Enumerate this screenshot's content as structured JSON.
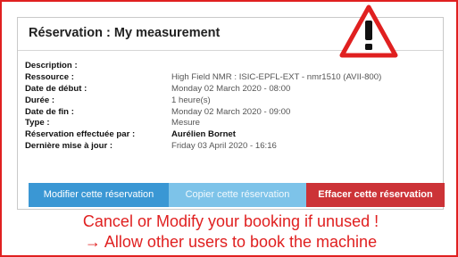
{
  "panel": {
    "title": "Réservation : My measurement",
    "rows": [
      {
        "label": "Description :",
        "value": ""
      },
      {
        "label": "Ressource :",
        "value": "High Field NMR : ISIC-EPFL-EXT - nmr1510 (AVII-800)"
      },
      {
        "label": "Date de début :",
        "value": "Monday 02 March 2020 - 08:00"
      },
      {
        "label": "Durée :",
        "value": "1 heure(s)"
      },
      {
        "label": "Date de fin :",
        "value": "Monday 02 March 2020 - 09:00"
      },
      {
        "label": "Type :",
        "value": "Mesure"
      },
      {
        "label": "Réservation effectuée par :",
        "value": "Aurélien Bornet"
      },
      {
        "label": "Dernière mise à jour :",
        "value": "Friday 03 April 2020 - 16:16"
      }
    ]
  },
  "buttons": {
    "modify_label": "Modifier cette réservation",
    "copy_label": "Copier cette réservation",
    "delete_label": "Effacer cette réservation"
  },
  "warning_icon": "warning-triangle-icon",
  "note": {
    "line1": "Cancel or Modify your booking if unused !",
    "line2": "→ Allow other users to book the machine"
  },
  "colors": {
    "accent_red": "#e02020",
    "modify_blue": "#3a97d4",
    "copy_blue": "#7dc3e9",
    "delete_red": "#cc3337"
  }
}
